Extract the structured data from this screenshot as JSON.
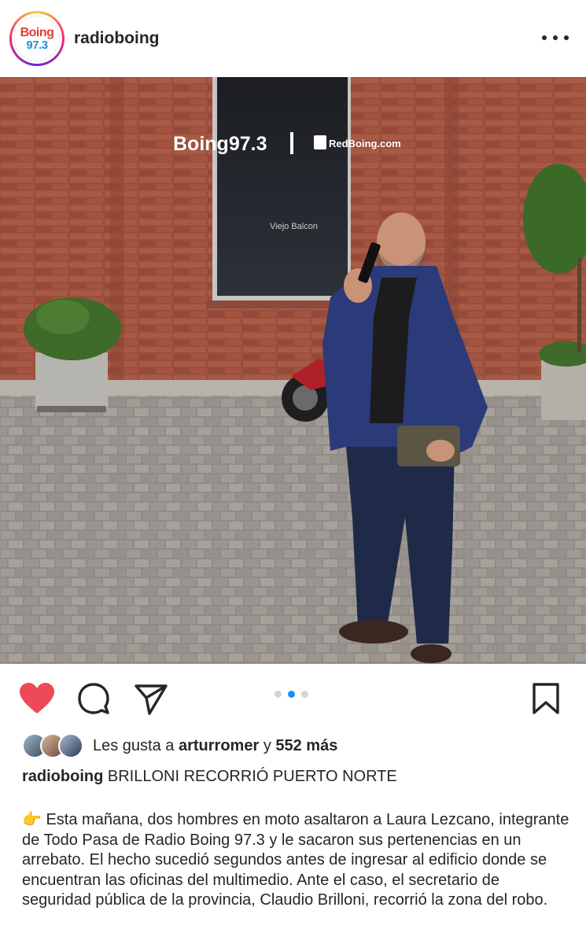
{
  "post": {
    "username": "radioboing",
    "avatar_text_1": "Boing",
    "avatar_text_2": "97.3",
    "more_icon": "more-horizontal-icon"
  },
  "photo": {
    "sign_brand": "Boing97.3",
    "sign_partner": "RedBoing.com",
    "window_text": "Viejo Balcon"
  },
  "actions": {
    "like_icon": "heart-filled-icon",
    "comment_icon": "comment-icon",
    "share_icon": "send-icon",
    "save_icon": "bookmark-icon",
    "carousel_total": 3,
    "carousel_active": 2,
    "like_color": "#ed4956",
    "dot_active_color": "#1a8ff0"
  },
  "likes": {
    "prefix": "Les gusta a",
    "user": "arturromer",
    "connector": "y",
    "count": "552 más"
  },
  "caption": {
    "username": "radioboing",
    "title": "BRILLONI RECORRIÓ PUERTO NORTE",
    "emoji": "👉",
    "body": "Esta mañana, dos hombres en moto asaltaron a Laura Lezcano, integrante de Todo Pasa de Radio Boing 97.3 y le sacaron sus pertenencias en un arrebato. El hecho sucedió segundos antes de ingresar al edificio donde se encuentran las oficinas del multimedio. Ante el caso, el secretario de seguridad pública de la provincia, Claudio Brilloni, recorrió la zona del robo."
  }
}
